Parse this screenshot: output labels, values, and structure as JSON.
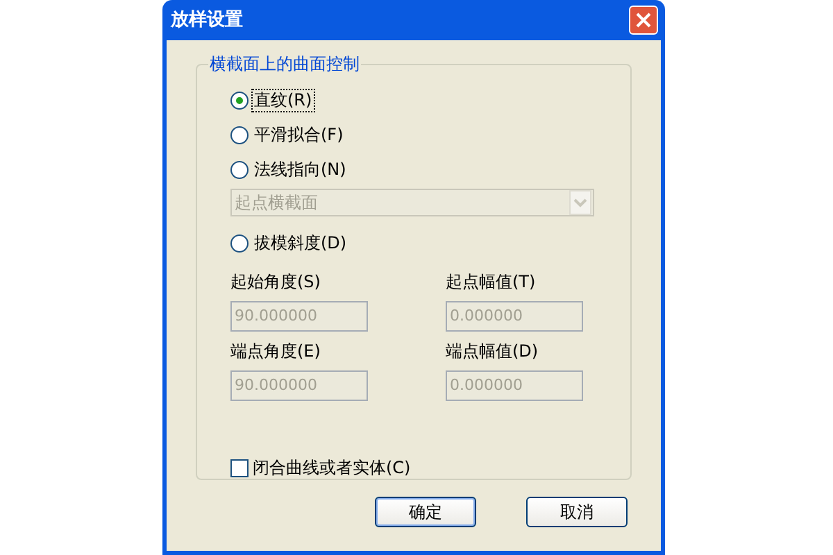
{
  "window": {
    "title": "放样设置"
  },
  "group": {
    "title": "横截面上的曲面控制",
    "options": [
      {
        "label": "直纹(R)",
        "selected": true
      },
      {
        "label": "平滑拟合(F)",
        "selected": false
      },
      {
        "label": "法线指向(N)",
        "selected": false
      },
      {
        "label": "拔模斜度(D)",
        "selected": false
      }
    ],
    "normal_dropdown": {
      "value": "起点横截面",
      "disabled": true
    },
    "fields": [
      {
        "label": "起始角度(S)",
        "value": "90.000000"
      },
      {
        "label": "起点幅值(T)",
        "value": "0.000000"
      },
      {
        "label": "端点角度(E)",
        "value": "90.000000"
      },
      {
        "label": "端点幅值(D)",
        "value": "0.000000"
      }
    ],
    "close_checkbox": {
      "label": "闭合曲线或者实体(C)",
      "checked": false
    }
  },
  "buttons": [
    "确定",
    "取消"
  ]
}
